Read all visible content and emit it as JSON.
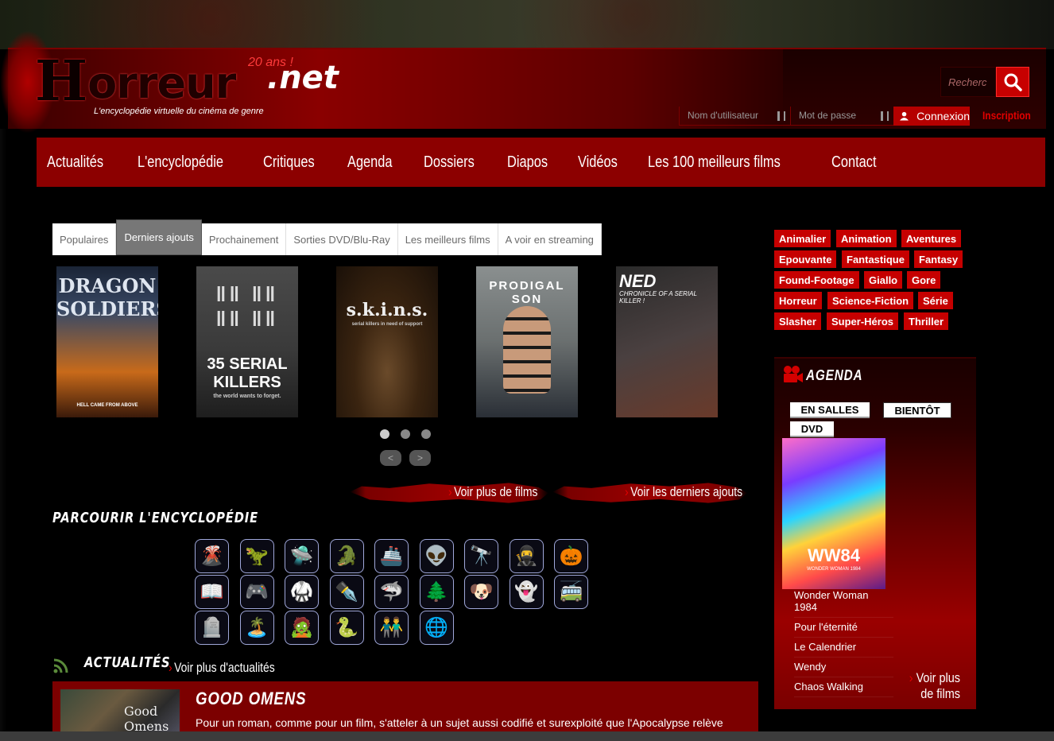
{
  "header": {
    "logo_h": "H",
    "logo_rest": "orreur",
    "logo_net": ".net",
    "logo_badge": "20 ans !",
    "tagline": "L'encyclopédie virtuelle du cinéma de genre",
    "search_placeholder": "Recherc",
    "username_placeholder": "Nom d'utilisateur",
    "password_placeholder": "Mot de passe",
    "login_label": "Connexion",
    "signup_label": "Inscription"
  },
  "nav": {
    "items": [
      "Actualités",
      "L'encyclopédie",
      "Critiques",
      "Agenda",
      "Dossiers",
      "Diapos",
      "Vidéos",
      "Les 100 meilleurs films",
      "Contact"
    ]
  },
  "tabs": {
    "items": [
      "Populaires",
      "Derniers ajouts",
      "Prochainement",
      "Sorties DVD/Blu-Ray",
      "Les meilleurs films",
      "A voir en streaming"
    ],
    "active": "Derniers ajouts"
  },
  "posters": [
    {
      "title": "DRAGON SOLDIERS",
      "caption": "HELL CAME FROM ABOVE"
    },
    {
      "title": "35 SERIAL KILLERS",
      "caption": "the world wants to forget."
    },
    {
      "title": "s.k.i.n.s.",
      "caption": "serial killers in need of support"
    },
    {
      "title": "PRODIGAL SON",
      "caption": ""
    },
    {
      "title": "NED",
      "caption": "CHRONICLE OF A SERIAL KILLER !"
    }
  ],
  "carousel": {
    "prev": "<",
    "next": ">"
  },
  "links": {
    "more_films": "Voir plus de films",
    "latest_adds": "Voir les derniers ajouts",
    "chevron": "›"
  },
  "encyclopedia": {
    "title": "PARCOURIR L'ENCYCLOPÉDIE",
    "icons": [
      "🌋",
      "🦖",
      "🛸",
      "🐊",
      "🚢",
      "👽",
      "🔭",
      "🥷",
      "🎃",
      "📖",
      "🎮",
      "🥋",
      "✒️",
      "🦈",
      "🌲",
      "🐶",
      "👻",
      "🚎",
      "🪦",
      "🏝️",
      "🧟",
      "🐍",
      "👬",
      "🌐"
    ]
  },
  "news": {
    "title": "ACTUALITÉS",
    "more": "Voir plus d'actualités",
    "article_title": "GOOD OMENS",
    "article_text": "Pour un roman, comme pour un film, s'atteler à un sujet aussi codifié et surexploité que l'Apocalypse relève",
    "image_text": "Good Omens"
  },
  "genres": [
    "Animalier",
    "Animation",
    "Aventures",
    "Epouvante",
    "Fantastique",
    "Fantasy",
    "Found-Footage",
    "Giallo",
    "Gore",
    "Horreur",
    "Science-Fiction",
    "Série",
    "Slasher",
    "Super-Héros",
    "Thriller"
  ],
  "agenda": {
    "title": "AGENDA",
    "tabs": [
      "EN SALLES",
      "BIENTÔT",
      "DVD"
    ],
    "active_tab": "BIENTÔT",
    "poster_title": "WW84",
    "poster_sub": "WONDER WOMAN 1984",
    "items": [
      "Wonder Woman 1984",
      "Pour l'éternité",
      "Le Calendrier",
      "Wendy",
      "Chaos Walking"
    ],
    "more": "Voir plus de films"
  },
  "colors": {
    "accent": "#c60000",
    "nav": "#8c0000",
    "link_chevron": "#e20000"
  }
}
